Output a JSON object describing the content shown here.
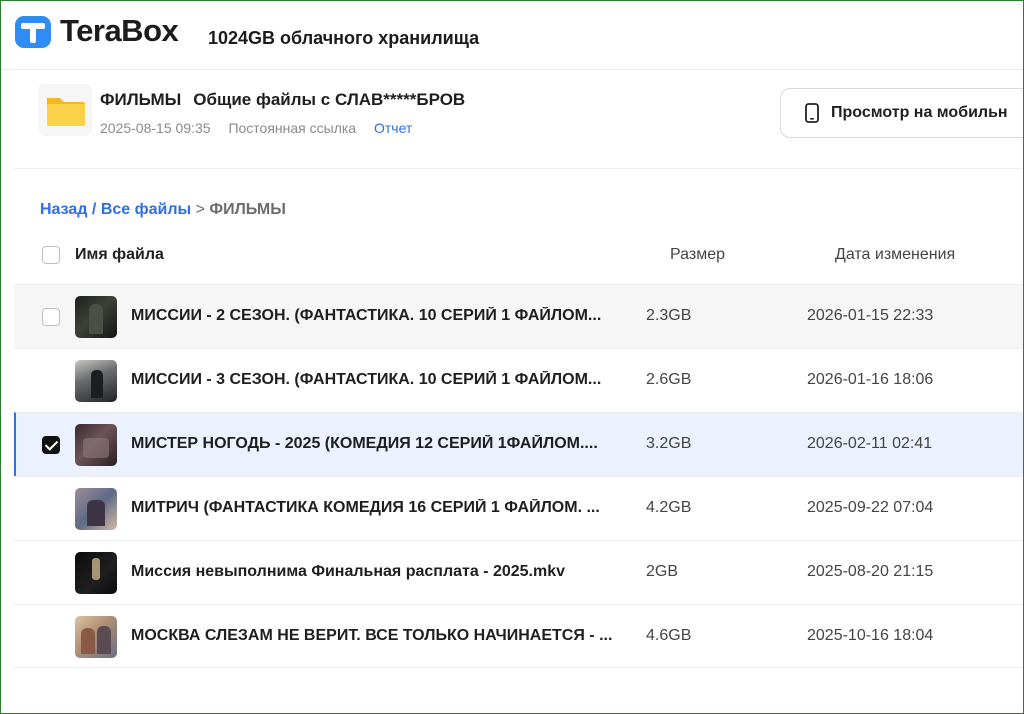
{
  "header": {
    "logo_text": "TeraBox",
    "tagline": "1024GB облачного хранилища"
  },
  "share": {
    "folder_name": "ФИЛЬМЫ",
    "subtitle": "Общие файлы с СЛАВ*****БРОВ",
    "date": "2025-08-15 09:35",
    "link_type": "Постоянная ссылка",
    "report_label": "Отчет",
    "mobile_button_label": "Просмотр на мобильн"
  },
  "breadcrumb": {
    "back": "Назад",
    "separator1": "/",
    "all_files": "Все файлы",
    "separator2": ">",
    "current": "ФИЛЬМЫ"
  },
  "table": {
    "columns": {
      "name": "Имя файла",
      "size": "Размер",
      "date": "Дата изменения"
    },
    "rows": [
      {
        "name": "МИССИИ - 2 СЕЗОН. (ФАНТАСТИКА. 10 СЕРИЙ 1 ФАЙЛОМ...",
        "size": "2.3GB",
        "date": "2026-01-15 22:33",
        "state": "hover",
        "checked": false
      },
      {
        "name": "МИССИИ - 3 СЕЗОН. (ФАНТАСТИКА. 10 СЕРИЙ 1 ФАЙЛОМ...",
        "size": "2.6GB",
        "date": "2026-01-16 18:06",
        "state": "normal",
        "checked": false
      },
      {
        "name": "МИСТЕР НОГОДЬ - 2025 (КОМЕДИЯ 12 СЕРИЙ 1ФАЙЛОМ....",
        "size": "3.2GB",
        "date": "2026-02-11 02:41",
        "state": "selected",
        "checked": true
      },
      {
        "name": "МИТРИЧ (ФАНТАСТИКА КОМЕДИЯ 16 СЕРИЙ 1 ФАЙЛОМ. ...",
        "size": "4.2GB",
        "date": "2025-09-22 07:04",
        "state": "normal",
        "checked": false
      },
      {
        "name": "Миссия невыполнима Финальная расплата - 2025.mkv",
        "size": "2GB",
        "date": "2025-08-20 21:15",
        "state": "normal",
        "checked": false
      },
      {
        "name": "МОСКВА СЛЕЗАМ НЕ ВЕРИТ. ВСЕ ТОЛЬКО НАЧИНАЕТСЯ - ...",
        "size": "4.6GB",
        "date": "2025-10-16 18:04",
        "state": "normal",
        "checked": false
      }
    ]
  },
  "colors": {
    "accent": "#2f6ee8",
    "selected_row": "#ebf1fd",
    "folder": "#f7c431"
  }
}
